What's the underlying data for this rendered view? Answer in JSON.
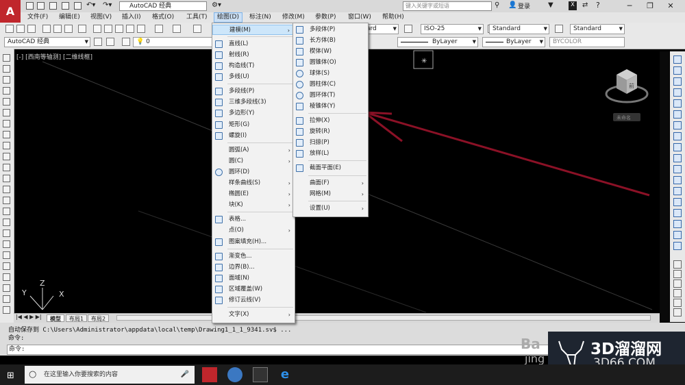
{
  "titlebar": {
    "workspace": "AutoCAD 经典",
    "search_placeholder": "键入关键字或短语",
    "login": "登录",
    "logo": "A"
  },
  "menubar": [
    "文件(F)",
    "编辑(E)",
    "视图(V)",
    "插入(I)",
    "格式(O)",
    "工具(T)",
    "绘图(D)",
    "标注(N)",
    "修改(M)",
    "参数(P)",
    "窗口(W)",
    "帮助(H)"
  ],
  "toolbar1": {
    "dimstyle": "ISO-25",
    "textstyle": "Standard",
    "tablestyle": "Standard",
    "style_left": "ard"
  },
  "toolbar2": {
    "workspace": "AutoCAD 经典",
    "layer": "0",
    "linetype1": "ByLayer",
    "linetype2": "ByLayer",
    "color": "BYCOLOR"
  },
  "canvas": {
    "viewport_label": "[-] [西南等轴测] [二维线框]",
    "cube_face": "前",
    "cube_label": "未命名",
    "ucs": {
      "z": "Z",
      "y": "Y",
      "x": "X"
    }
  },
  "tabs": [
    "模型",
    "布局1",
    "布局2"
  ],
  "command": {
    "line1": "自动保存到  C:\\Users\\Administrator\\appdata\\local\\temp\\Drawing1_1_1_9341.sv$ ...",
    "line2": "命令:",
    "prompt": "命令:"
  },
  "taskbar": {
    "search": "在这里输入你要搜索的内容"
  },
  "watermark": {
    "text1": "3D溜溜网",
    "text2": "3D66.COM",
    "partial": "Ba",
    "partial2": "jing"
  },
  "draw_menu": [
    {
      "label": "建模(M)",
      "sub": true,
      "icon": "none"
    },
    {
      "label": "直线(L)",
      "icon": "line-icon"
    },
    {
      "label": "射线(R)",
      "icon": "ray-icon"
    },
    {
      "label": "构造线(T)",
      "icon": "xline-icon"
    },
    {
      "label": "多线(U)",
      "icon": "mline-icon"
    },
    {
      "label": "多段线(P)",
      "icon": "polyline-icon"
    },
    {
      "label": "三维多段线(3)",
      "icon": "3dpoly-icon"
    },
    {
      "label": "多边形(Y)",
      "icon": "polygon-icon"
    },
    {
      "label": "矩形(G)",
      "icon": "rectangle-icon"
    },
    {
      "label": "螺旋(I)",
      "icon": "helix-icon"
    },
    {
      "label": "圆弧(A)",
      "sub": true
    },
    {
      "label": "圆(C)",
      "sub": true
    },
    {
      "label": "圆环(D)",
      "icon": "donut-icon"
    },
    {
      "label": "样条曲线(S)",
      "sub": true
    },
    {
      "label": "椭圆(E)",
      "sub": true
    },
    {
      "label": "块(K)",
      "sub": true
    },
    {
      "label": "表格...",
      "icon": "table-icon"
    },
    {
      "label": "点(O)",
      "sub": true
    },
    {
      "label": "图案填充(H)...",
      "icon": "hatch-icon"
    },
    {
      "label": "渐变色...",
      "icon": "gradient-icon"
    },
    {
      "label": "边界(B)...",
      "icon": "boundary-icon"
    },
    {
      "label": "面域(N)",
      "icon": "region-icon"
    },
    {
      "label": "区域覆盖(W)",
      "icon": "wipeout-icon"
    },
    {
      "label": "修订云线(V)",
      "icon": "revcloud-icon"
    },
    {
      "label": "文字(X)",
      "sub": true
    }
  ],
  "modeling_menu": [
    {
      "label": "多段体(P)",
      "icon": "polysolid-icon"
    },
    {
      "label": "长方体(B)",
      "icon": "box-icon"
    },
    {
      "label": "楔体(W)",
      "icon": "wedge-icon"
    },
    {
      "label": "圆锥体(O)",
      "icon": "cone-icon"
    },
    {
      "label": "球体(S)",
      "icon": "sphere-icon"
    },
    {
      "label": "圆柱体(C)",
      "icon": "cylinder-icon"
    },
    {
      "label": "圆环体(T)",
      "icon": "torus-icon"
    },
    {
      "label": "棱锥体(Y)",
      "icon": "pyramid-icon"
    },
    {
      "label": "拉伸(X)",
      "icon": "extrude-icon"
    },
    {
      "label": "旋转(R)",
      "icon": "revolve-icon"
    },
    {
      "label": "扫掠(P)",
      "icon": "sweep-icon"
    },
    {
      "label": "放样(L)",
      "icon": "loft-icon"
    },
    {
      "label": "截面平面(E)",
      "icon": "sectionplane-icon"
    },
    {
      "label": "曲面(F)",
      "sub": true
    },
    {
      "label": "网格(M)",
      "sub": true
    },
    {
      "label": "设置(U)",
      "sub": true
    }
  ],
  "colors": {
    "arrow": "#8b1126",
    "highlight": "#cde6fa",
    "logo": "#c0262c"
  }
}
